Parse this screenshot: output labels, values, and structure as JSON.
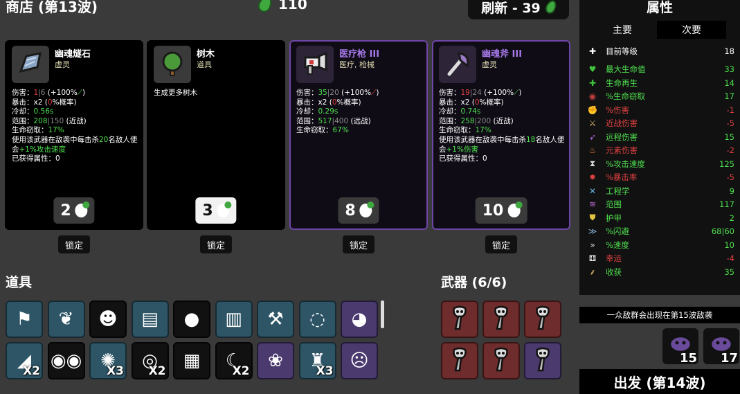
{
  "header": {
    "shop_title": "商店 (第13波)",
    "materials": "110",
    "refresh_label": "刷新 - 39"
  },
  "cards": [
    {
      "name": "幽魂燧石",
      "type": "虚灵",
      "icon": "flint-icon",
      "rarity": "common",
      "lines": [
        [
          [
            "伤害：",
            ""
          ],
          [
            "1",
            "r"
          ],
          [
            "|",
            "gy"
          ],
          [
            "6",
            "gy"
          ],
          [
            " (+100%",
            ""
          ],
          [
            "⟋",
            "g"
          ],
          [
            ")",
            ""
          ]
        ],
        [
          [
            "暴击：x2 (",
            ""
          ],
          [
            "0",
            "r"
          ],
          [
            "%概率)",
            ""
          ]
        ],
        [
          [
            "冷却：",
            ""
          ],
          [
            "0.56s",
            "g"
          ]
        ],
        [
          [
            "范围：",
            ""
          ],
          [
            "208",
            "g"
          ],
          [
            "|",
            "gy"
          ],
          [
            "150",
            "gy"
          ],
          [
            " (近战)",
            ""
          ]
        ],
        [
          [
            "生命窃取：",
            ""
          ],
          [
            "17%",
            "g"
          ]
        ],
        [
          [
            "使用该武器在敌袭中每击杀",
            ""
          ],
          [
            "20",
            "g"
          ],
          [
            "名敌人便会",
            ""
          ],
          [
            "+1%攻击速度",
            "g"
          ]
        ],
        [
          [
            "已获得属性：0",
            ""
          ]
        ]
      ],
      "price": "2",
      "selected": false,
      "lock": "锁定"
    },
    {
      "name": "树木",
      "type": "道具",
      "icon": "tree-icon",
      "rarity": "common",
      "lines": [
        [
          [
            "生成更多树木",
            ""
          ]
        ]
      ],
      "price": "3",
      "selected": true,
      "lock": "锁定"
    },
    {
      "name": "医疗枪 III",
      "type": "医疗, 枪械",
      "icon": "medical-gun-icon",
      "rarity": "rare",
      "lines": [
        [
          [
            "伤害：",
            ""
          ],
          [
            "35",
            "g"
          ],
          [
            "|",
            "gy"
          ],
          [
            "20",
            "gy"
          ],
          [
            " (+100%",
            ""
          ],
          [
            "⟋",
            "pr"
          ],
          [
            ")",
            ""
          ]
        ],
        [
          [
            "暴击：x2 (",
            ""
          ],
          [
            "0",
            "r"
          ],
          [
            "%概率)",
            ""
          ]
        ],
        [
          [
            "冷却：",
            ""
          ],
          [
            "0.29s",
            "g"
          ]
        ],
        [
          [
            "范围：",
            ""
          ],
          [
            "517",
            "g"
          ],
          [
            "|",
            "gy"
          ],
          [
            "400",
            "gy"
          ],
          [
            " (远战)",
            ""
          ]
        ],
        [
          [
            "生命窃取：",
            ""
          ],
          [
            "67%",
            "g"
          ]
        ]
      ],
      "price": "8",
      "selected": false,
      "lock": "锁定"
    },
    {
      "name": "幽魂斧 III",
      "type": "虚灵",
      "icon": "ghost-axe-icon",
      "rarity": "rare",
      "lines": [
        [
          [
            "伤害：",
            ""
          ],
          [
            "19",
            "r"
          ],
          [
            "|",
            "gy"
          ],
          [
            "24",
            "gy"
          ],
          [
            " (+100%",
            ""
          ],
          [
            "⟋",
            "g"
          ],
          [
            ")",
            ""
          ]
        ],
        [
          [
            "暴击：x2 (",
            ""
          ],
          [
            "0",
            "r"
          ],
          [
            "%概率)",
            ""
          ]
        ],
        [
          [
            "冷却：",
            ""
          ],
          [
            "0.74s",
            "g"
          ]
        ],
        [
          [
            "范围：",
            ""
          ],
          [
            "258",
            "g"
          ],
          [
            "|",
            "gy"
          ],
          [
            "200",
            "gy"
          ],
          [
            " (近战)",
            ""
          ]
        ],
        [
          [
            "生命窃取：",
            ""
          ],
          [
            "17%",
            "g"
          ]
        ],
        [
          [
            "使用该武器在敌袭中每击杀",
            ""
          ],
          [
            "18",
            "g"
          ],
          [
            "名敌人便会",
            ""
          ],
          [
            "+1%伤害",
            "g"
          ]
        ],
        [
          [
            "已获得属性：0",
            ""
          ]
        ]
      ],
      "price": "10",
      "selected": false,
      "lock": "锁定"
    }
  ],
  "items_section": {
    "title": "道具",
    "slots": [
      {
        "icon": "axe-flag-icon",
        "glyph": "⚑",
        "bg": "n",
        "count": ""
      },
      {
        "icon": "larva-icon",
        "glyph": "❦",
        "bg": "n",
        "count": ""
      },
      {
        "icon": "panda-face-icon",
        "glyph": "☻",
        "bg": "b",
        "count": ""
      },
      {
        "icon": "scarf-icon",
        "glyph": "▤",
        "bg": "n",
        "count": ""
      },
      {
        "icon": "bombs-icon",
        "glyph": "●",
        "bg": "b",
        "count": ""
      },
      {
        "icon": "bandage-icon",
        "glyph": "▥",
        "bg": "n",
        "count": ""
      },
      {
        "icon": "shovel-icon",
        "glyph": "⚒",
        "bg": "n",
        "count": ""
      },
      {
        "icon": "amulet-icon",
        "glyph": "◌",
        "bg": "n",
        "count": ""
      },
      {
        "icon": "pink-blob-icon",
        "glyph": "◕",
        "bg": "p",
        "count": ""
      },
      {
        "icon": "blade-icon",
        "glyph": "◢",
        "bg": "n",
        "count": "X2"
      },
      {
        "icon": "glasses-icon",
        "glyph": "◉◉",
        "bg": "b",
        "count": ""
      },
      {
        "icon": "wasp-icon",
        "glyph": "✺",
        "bg": "n",
        "count": "X3"
      },
      {
        "icon": "scroll-icon",
        "glyph": "◎",
        "bg": "b",
        "count": "X2"
      },
      {
        "icon": "jacket-icon",
        "glyph": "▦",
        "bg": "b",
        "count": ""
      },
      {
        "icon": "fang-icon",
        "glyph": "☾",
        "bg": "b",
        "count": "X2"
      },
      {
        "icon": "chameleon-icon",
        "glyph": "❀",
        "bg": "p",
        "count": ""
      },
      {
        "icon": "cape-icon",
        "glyph": "♜",
        "bg": "n",
        "count": "X3"
      },
      {
        "icon": "ghost-icon",
        "glyph": "☹",
        "bg": "p",
        "count": ""
      }
    ]
  },
  "weapons_section": {
    "title": "武器 (6/6)",
    "slots": [
      {
        "icon": "medical-gun-icon",
        "bg": "rd"
      },
      {
        "icon": "medical-gun-icon",
        "bg": "rd"
      },
      {
        "icon": "medical-gun-icon",
        "bg": "rd"
      },
      {
        "icon": "medical-gun-icon",
        "bg": "rd"
      },
      {
        "icon": "medical-gun-icon",
        "bg": "rd"
      },
      {
        "icon": "medical-gun-icon",
        "bg": "p"
      }
    ]
  },
  "stats_panel": {
    "title": "属性",
    "tabs": [
      "主要",
      "次要"
    ],
    "active_tab": 1,
    "rows": [
      {
        "label": "目前等级",
        "value": "18",
        "icon": "level-icon",
        "glyph": "✚",
        "icon_color": "#ffffff",
        "label_color": "#ffffff",
        "value_color": "#ffffff"
      },
      {
        "label": "最大生命值",
        "value": "33",
        "icon": "heart-icon",
        "glyph": "♥",
        "icon_color": "#3fc43f",
        "label_color": "#4fe04f",
        "value_color": "#4fe04f"
      },
      {
        "label": "生命再生",
        "value": "14",
        "icon": "regen-icon",
        "glyph": "✚",
        "icon_color": "#3fc43f",
        "label_color": "#4fe04f",
        "value_color": "#4fe04f"
      },
      {
        "label": "%生命窃取",
        "value": "17",
        "icon": "lifesteal-icon",
        "glyph": "◉",
        "icon_color": "#c43f3f",
        "label_color": "#4fe04f",
        "value_color": "#4fe04f"
      },
      {
        "label": "%伤害",
        "value": "-1",
        "icon": "damage-icon",
        "glyph": "✊",
        "icon_color": "#e04a4a",
        "label_color": "#e04040",
        "value_color": "#e04040"
      },
      {
        "label": "近战伤害",
        "value": "-5",
        "icon": "melee-icon",
        "glyph": "⚔",
        "icon_color": "#d9b46a",
        "label_color": "#e04040",
        "value_color": "#e04040"
      },
      {
        "label": "远程伤害",
        "value": "15",
        "icon": "ranged-icon",
        "glyph": "➶",
        "icon_color": "#b46ad9",
        "label_color": "#4fe04f",
        "value_color": "#4fe04f"
      },
      {
        "label": "元素伤害",
        "value": "-2",
        "icon": "elemental-icon",
        "glyph": "♨",
        "icon_color": "#e07a3a",
        "label_color": "#e04040",
        "value_color": "#e04040"
      },
      {
        "label": "%攻击速度",
        "value": "125",
        "icon": "attack-speed-icon",
        "glyph": "⧗",
        "icon_color": "#dddddd",
        "label_color": "#4fe04f",
        "value_color": "#4fe04f"
      },
      {
        "label": "%暴击率",
        "value": "-5",
        "icon": "crit-icon",
        "glyph": "✸",
        "icon_color": "#e04040",
        "label_color": "#e04040",
        "value_color": "#e04040"
      },
      {
        "label": "工程学",
        "value": "9",
        "icon": "engineering-icon",
        "glyph": "✕",
        "icon_color": "#6ab4e0",
        "label_color": "#4fe04f",
        "value_color": "#4fe04f"
      },
      {
        "label": "范围",
        "value": "117",
        "icon": "range-icon",
        "glyph": "≋",
        "icon_color": "#c46ad9",
        "label_color": "#4fe04f",
        "value_color": "#4fe04f"
      },
      {
        "label": "护甲",
        "value": "2",
        "icon": "armor-icon",
        "glyph": "⛊",
        "icon_color": "#e0c43f",
        "label_color": "#4fe04f",
        "value_color": "#4fe04f"
      },
      {
        "label": "%闪避",
        "value": "68|60",
        "icon": "dodge-icon",
        "glyph": "≫",
        "icon_color": "#8ab4e0",
        "label_color": "#4fe04f",
        "value_color": "#4fe04f"
      },
      {
        "label": "%速度",
        "value": "10",
        "icon": "speed-icon",
        "glyph": "»",
        "icon_color": "#dddddd",
        "label_color": "#4fe04f",
        "value_color": "#4fe04f"
      },
      {
        "label": "幸运",
        "value": "-4",
        "icon": "luck-icon",
        "glyph": "⚅",
        "icon_color": "#ffffff",
        "label_color": "#e04040",
        "value_color": "#e04040"
      },
      {
        "label": "收获",
        "value": "35",
        "icon": "harvest-icon",
        "glyph": "⸙",
        "icon_color": "#e0c46a",
        "label_color": "#4fe04f",
        "value_color": "#4fe04f"
      }
    ]
  },
  "wave_note": "一众敌群会出现在第15波敌袭",
  "enemies": [
    {
      "icon": "enemy-blob-icon",
      "count": "15"
    },
    {
      "icon": "enemy-horned-icon",
      "count": "17"
    }
  ],
  "go_button": "出发 (第14波)"
}
